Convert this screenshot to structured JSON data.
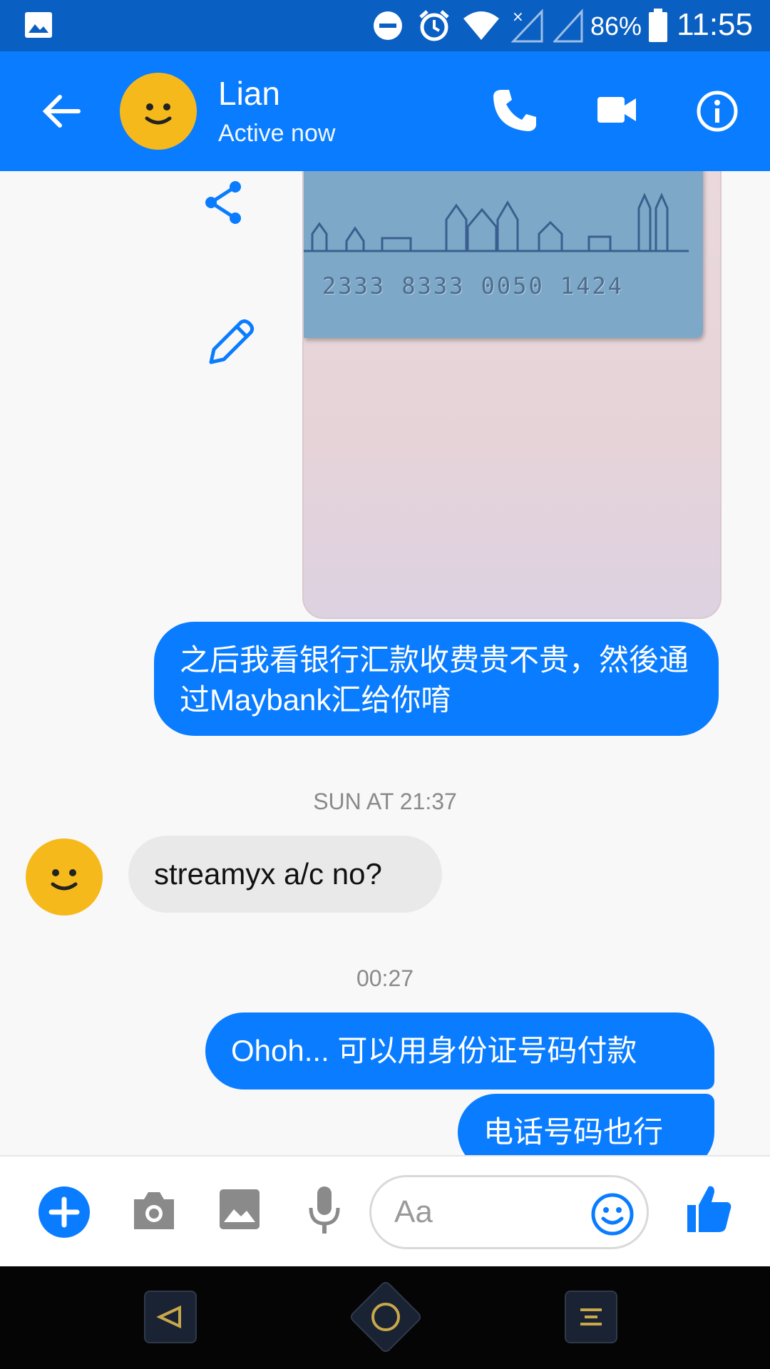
{
  "status_bar": {
    "battery_percent": "86%",
    "time": "11:55",
    "icons": [
      "image-icon",
      "do-not-disturb-icon",
      "alarm-icon",
      "wifi-icon",
      "signal-off-icon",
      "signal-icon",
      "battery-icon"
    ]
  },
  "header": {
    "contact_name": "Lian",
    "presence": "Active now",
    "actions": [
      "back-arrow-icon",
      "phone-icon",
      "video-camera-icon",
      "info-icon"
    ]
  },
  "chat": {
    "card_number": "2333 8333 0050 1424",
    "message_1": "之后我看银行汇款收费贵不贵，然後通过Maybank汇给你唷",
    "timestamp_1": "SUN AT 21:37",
    "message_2": "streamyx a/c no?",
    "timestamp_2": "00:27",
    "message_3": "Ohoh... 可以用身份证号码付款",
    "message_4": "电话号码也行"
  },
  "composer": {
    "placeholder": "Aa",
    "icons": [
      "add-icon",
      "camera-icon",
      "gallery-icon",
      "microphone-icon",
      "emoji-icon",
      "thumbs-up-icon"
    ]
  },
  "colors": {
    "brand_blue": "#0a7cff",
    "status_bar_blue": "#0a5fc2",
    "avatar_yellow": "#f6b91b"
  }
}
